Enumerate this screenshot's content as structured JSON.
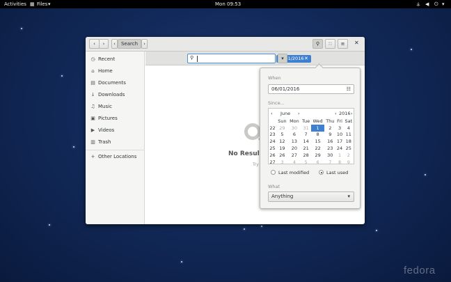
{
  "topbar": {
    "activities": "Activities",
    "app_menu": "Files",
    "clock": "Mon 09:53"
  },
  "header": {
    "path_label": "Search"
  },
  "sidebar": {
    "items": [
      {
        "label": "Recent",
        "icon": "clock-icon"
      },
      {
        "label": "Home",
        "icon": "home-icon"
      },
      {
        "label": "Documents",
        "icon": "document-icon"
      },
      {
        "label": "Downloads",
        "icon": "download-icon"
      },
      {
        "label": "Music",
        "icon": "music-icon"
      },
      {
        "label": "Pictures",
        "icon": "pictures-icon"
      },
      {
        "label": "Videos",
        "icon": "video-icon"
      },
      {
        "label": "Trash",
        "icon": "trash-icon"
      }
    ],
    "other_locations": "Other Locations"
  },
  "search": {
    "query": "",
    "date_chip": "06/01/2016"
  },
  "empty_state": {
    "title": "No Results",
    "subtitle": "Try a different"
  },
  "popover": {
    "when_label": "When",
    "date_value": "06/01/2016",
    "since_label": "Since...",
    "month": "June",
    "year": "2016",
    "weekdays": [
      "Sun",
      "Mon",
      "Tue",
      "Wed",
      "Thu",
      "Fri",
      "Sat"
    ],
    "weeks": [
      {
        "week": "22",
        "days": [
          "29",
          "30",
          "31",
          "1",
          "2",
          "3",
          "4"
        ]
      },
      {
        "week": "23",
        "days": [
          "5",
          "6",
          "7",
          "8",
          "9",
          "10",
          "11"
        ]
      },
      {
        "week": "24",
        "days": [
          "12",
          "13",
          "14",
          "15",
          "16",
          "17",
          "18"
        ]
      },
      {
        "week": "25",
        "days": [
          "19",
          "20",
          "21",
          "22",
          "23",
          "24",
          "25"
        ]
      },
      {
        "week": "26",
        "days": [
          "26",
          "27",
          "28",
          "29",
          "30",
          "1",
          "2"
        ]
      },
      {
        "week": "27",
        "days": [
          "3",
          "4",
          "5",
          "6",
          "7",
          "8",
          "9"
        ]
      }
    ],
    "last_modified_label": "Last modified",
    "last_used_label": "Last used",
    "what_label": "What",
    "what_value": "Anything"
  },
  "wallpaper_logo": "fedora",
  "colors": {
    "accent": "#3d7fd0",
    "topbar": "#000000",
    "desktop": "#122a5a"
  }
}
